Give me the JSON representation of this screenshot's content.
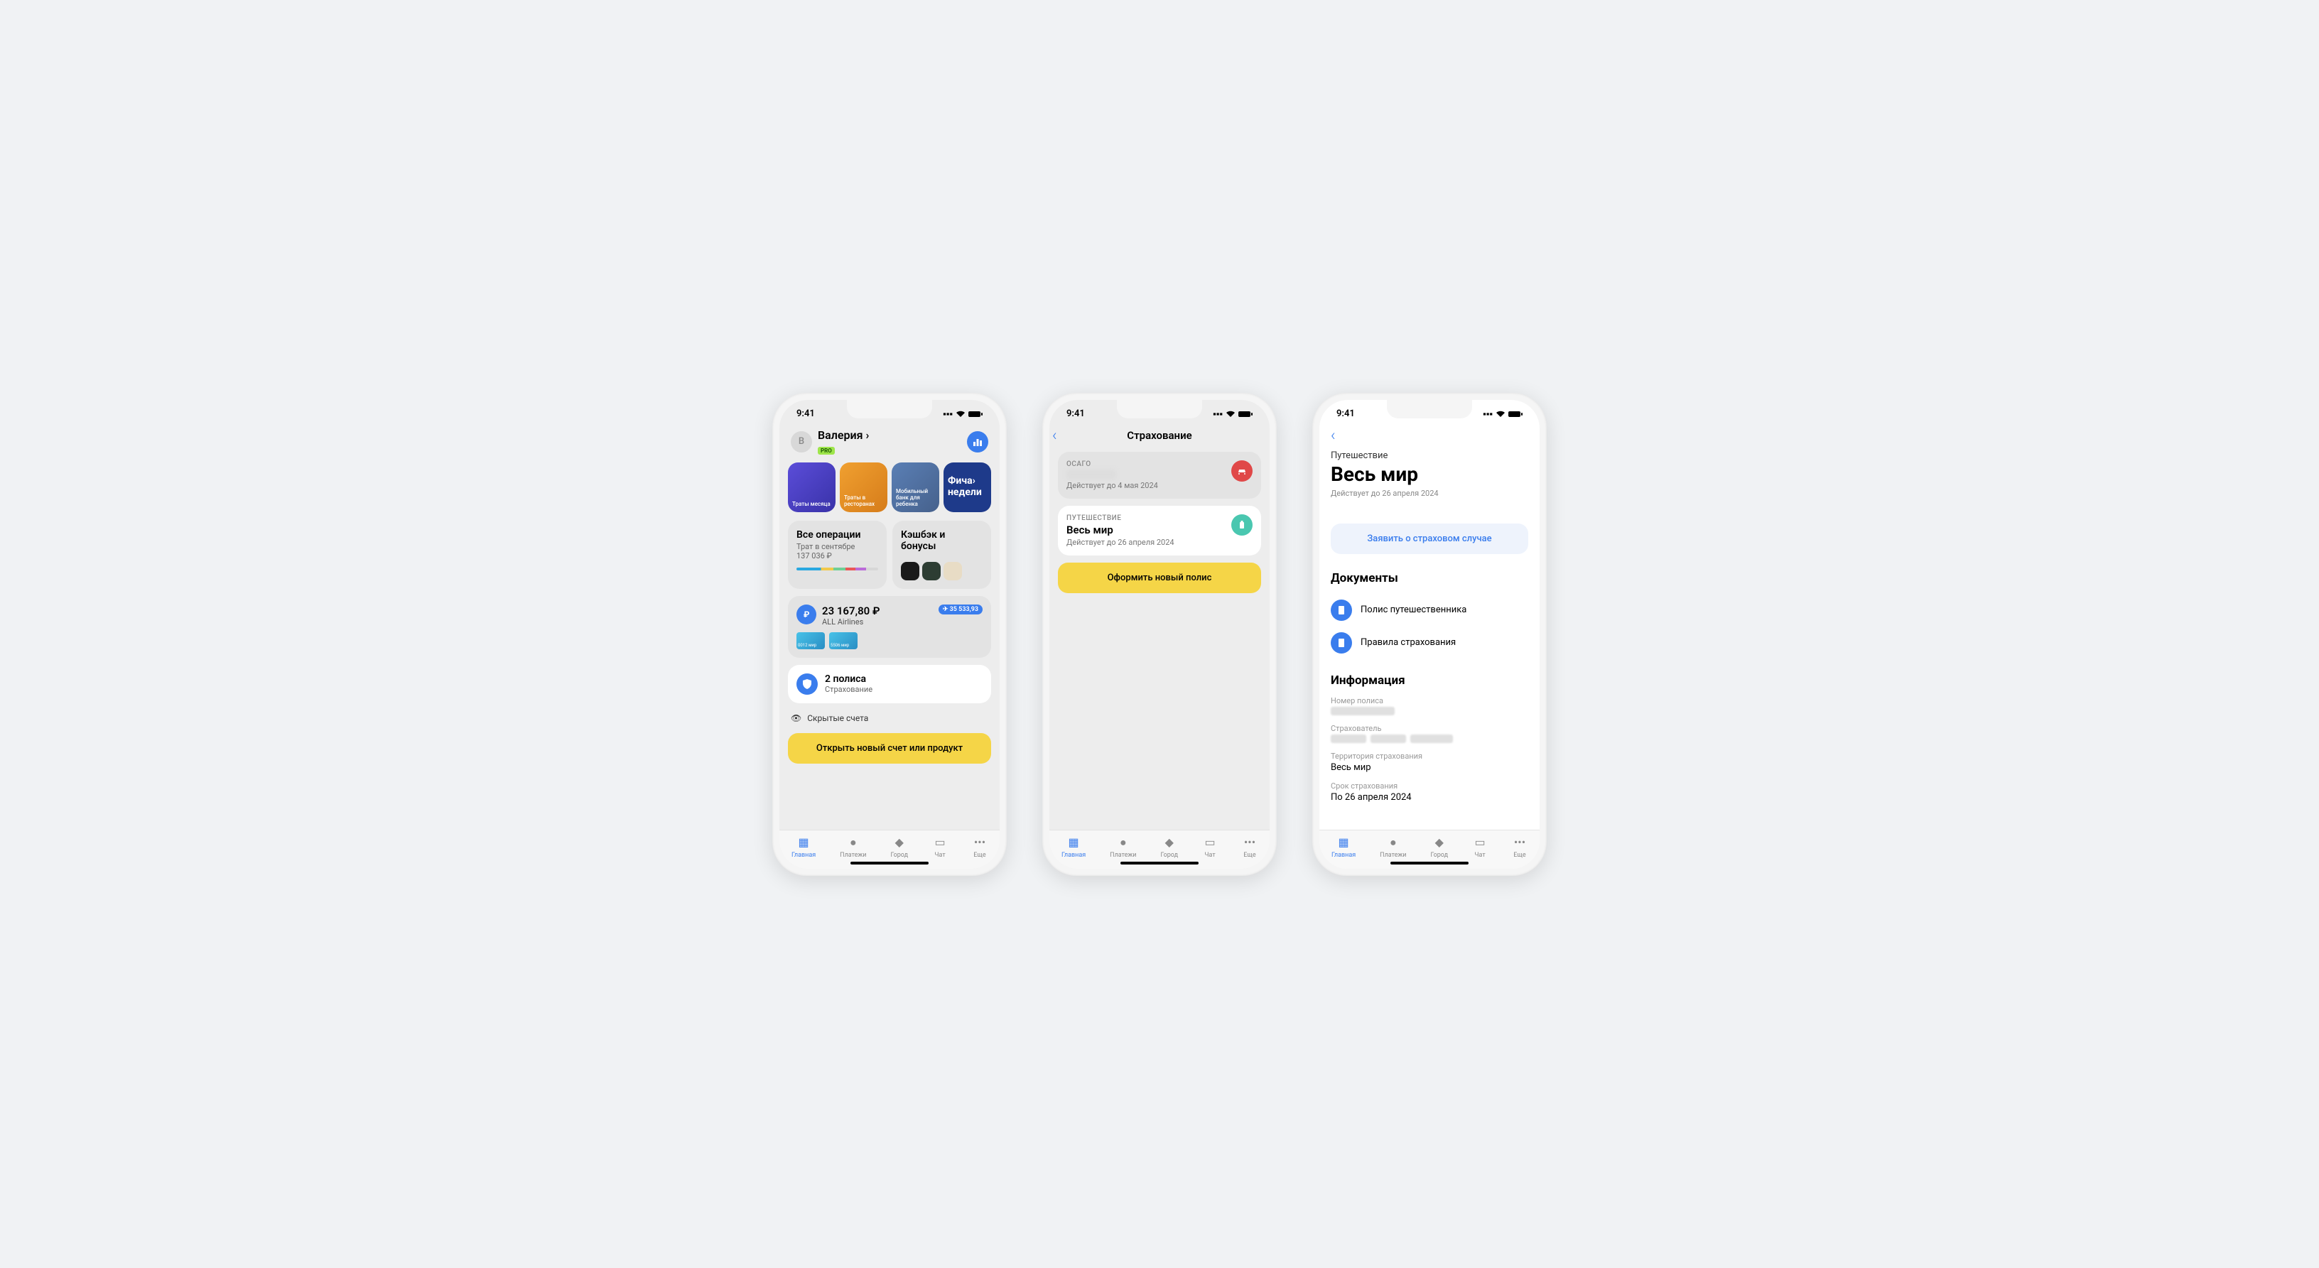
{
  "statusbar": {
    "time": "9:41"
  },
  "tabbar": {
    "home": "Главная",
    "payments": "Платежи",
    "city": "Город",
    "chat": "Чат",
    "more": "Еще"
  },
  "screen1": {
    "user": {
      "initial": "В",
      "name": "Валерия ›",
      "pro": "PRO"
    },
    "stories": {
      "s1": "Траты месяца",
      "s2": "Траты в ресторанах",
      "s3": "Мобильный банк для ребенка",
      "s4": "Фича› недели"
    },
    "ops": {
      "title": "Все операции",
      "sub": "Трат в сентябре",
      "amount": "137 036 ₽"
    },
    "cashback": {
      "title": "Кэшбэк и бонусы"
    },
    "account": {
      "amount": "23 167,80 ₽",
      "name": "ALL Airlines",
      "pill": "✈ 35 533,93",
      "c1": "0012 мир",
      "c2": "5506 мир"
    },
    "insurance": {
      "title": "2 полиса",
      "sub": "Страхование"
    },
    "hidden": "Скрытые счета",
    "open_button": "Открыть новый счет или продукт"
  },
  "screen2": {
    "title": "Страхование",
    "policy1": {
      "category": "ОСАГО",
      "valid": "Действует до 4 мая 2024"
    },
    "policy2": {
      "category": "ПУТЕШЕСТВИЕ",
      "name": "Весь мир",
      "valid": "Действует до 26 апреля 2024"
    },
    "button": "Оформить новый полис"
  },
  "screen3": {
    "subtitle": "Путешествие",
    "title": "Весь мир",
    "valid": "Действует до 26 апреля 2024",
    "claim": "Заявить о страховом случае",
    "docs_title": "Документы",
    "doc1": "Полис путешественника",
    "doc2": "Правила страхования",
    "info_title": "Информация",
    "info": {
      "policy_no_label": "Номер полиса",
      "insurer_label": "Страхователь",
      "territory_label": "Территория страхования",
      "territory_value": "Весь мир",
      "period_label": "Срок страхования",
      "period_value": "По 26 апреля 2024"
    }
  }
}
